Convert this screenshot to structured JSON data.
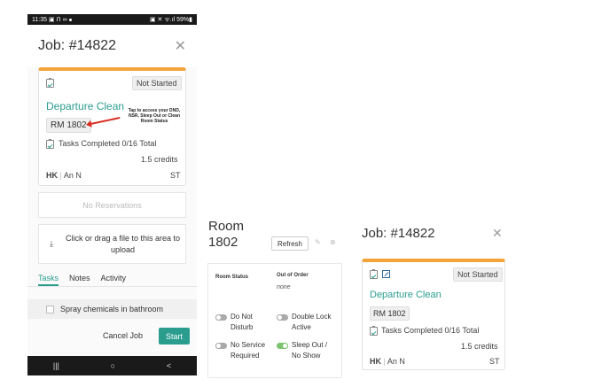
{
  "phone": {
    "status": {
      "time": "11:35",
      "indicators": "▣ ᑎ ∞",
      "right": "▣ ✕ ᯤ.ıl 59%▮"
    },
    "header": {
      "title": "Job: #14822",
      "close": "✕"
    },
    "card": {
      "status_badge": "Not Started",
      "title": "Departure Clean",
      "room": "RM 1802",
      "tasks": "Tasks Completed",
      "tasks_count": "0/16 Total",
      "credits": "1.5 credits",
      "hk_label": "HK",
      "assignee": "An N",
      "short": "ST"
    },
    "annotation": "Tap to access your DND, NSR, Sleep Out or Clean Room Status",
    "no_reservations": "No Reservations",
    "upload": {
      "icon": "⤓",
      "text": "Click or drag a file to this area to upload"
    },
    "tabs": [
      "Tasks",
      "Notes",
      "Activity"
    ],
    "task_item": "Spray chemicals in bathroom",
    "cancel": "Cancel Job",
    "start": "Start",
    "nav": [
      "|||",
      "○",
      "<"
    ]
  },
  "room": {
    "title": "Room 1802",
    "refresh": "Refresh",
    "edit_icon": "✎",
    "close_icon": "⊗",
    "status_label": "Room Status",
    "ooo_label": "Out of Order",
    "ooo_value": "none",
    "toggles": [
      {
        "label": "Do Not Disturb",
        "on": false
      },
      {
        "label": "Double Lock Active",
        "on": false
      },
      {
        "label": "No Service Required",
        "on": false
      },
      {
        "label": "Sleep Out / No Show",
        "on": true
      }
    ]
  },
  "job2": {
    "title": "Job: #14822",
    "close": "✕",
    "status_badge": "Not Started",
    "title_clean": "Departure Clean",
    "room": "RM 1802",
    "tasks": "Tasks Completed",
    "tasks_count": "0/16 Total",
    "credits": "1.5 credits",
    "hk_label": "HK",
    "assignee": "An N",
    "short": "ST"
  },
  "colors": {
    "accent": "#2a9d8f",
    "card_top": "#f3a43a",
    "arrow": "#d62d20",
    "toggle_on": "#7cc36f"
  }
}
